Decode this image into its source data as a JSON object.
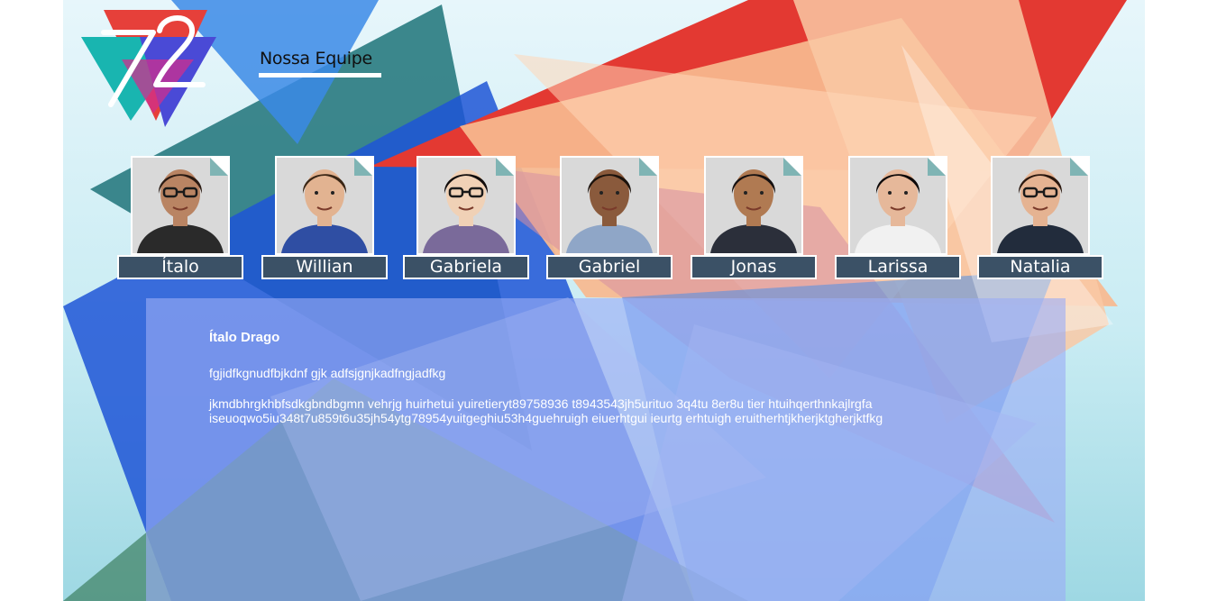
{
  "header": {
    "logo_icon": "triangles-72-logo",
    "nav_title": "Nossa Equipe"
  },
  "team": [
    {
      "name": "Ítalo",
      "shirt": "#2a2a2a",
      "skin": "#b98463",
      "hair": "#2a1a12",
      "glasses": true
    },
    {
      "name": "Willian",
      "shirt": "#2f4ea3",
      "skin": "#e2b391",
      "hair": "#3a2615",
      "glasses": false
    },
    {
      "name": "Gabriela",
      "shirt": "#7a6a9a",
      "skin": "#f0d1b6",
      "hair": "#120d0c",
      "glasses": true
    },
    {
      "name": "Gabriel",
      "shirt": "#8fa6c7",
      "skin": "#8a5a3c",
      "hair": "#1b120c",
      "glasses": false
    },
    {
      "name": "Jonas",
      "shirt": "#2b2f3a",
      "skin": "#b07a52",
      "hair": "#151010",
      "glasses": false
    },
    {
      "name": "Larissa",
      "shirt": "#f1f1f1",
      "skin": "#e6b89a",
      "hair": "#0d0909",
      "glasses": false
    },
    {
      "name": "Natalia",
      "shirt": "#222c3c",
      "skin": "#e5b392",
      "hair": "#2a170e",
      "glasses": true
    }
  ],
  "detail": {
    "name": "Ítalo Drago",
    "line1": "fgjidfkgnudfbjkdnf gjk adfsjgnjkadfngjadfkg",
    "line2": "jkmdbhrgkhbfsdkgbndbgmn vehrjg huirhetui yuiretieryt89758936 t8943543jh5urituo 3q4tu 8er8u tier htuihqerthnkajlrgfa iseuoqwo5iu348t7u859t6u35jh54ytg78954yuitgeghiu53h4guehruigh eiuerhtgui ieurtg erhtuigh eruitherhtjkherjktgherjktfkg"
  },
  "colors": {
    "accent_red": "#e83a35",
    "accent_blue": "#2b6de3",
    "accent_peach": "#f7b98f",
    "accent_teal": "#2e7f82",
    "name_bar": "#3b5166",
    "panel": "#9bacf5"
  }
}
